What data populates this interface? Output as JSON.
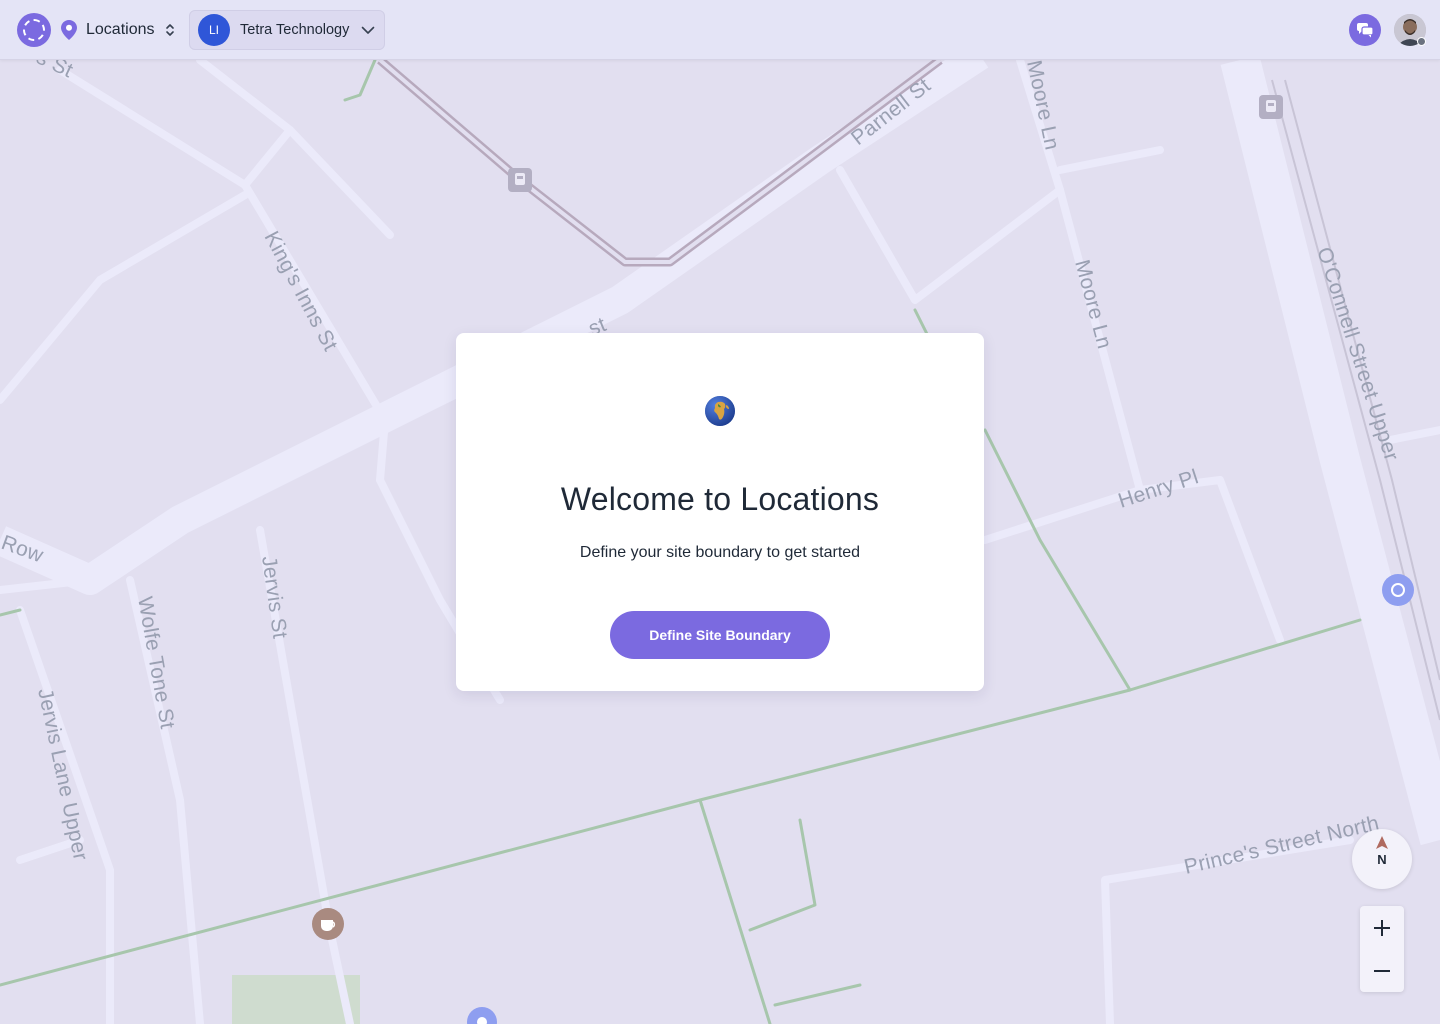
{
  "header": {
    "location_switcher_label": "Locations",
    "org": {
      "initials": "LI",
      "name": "Tetra Technology"
    }
  },
  "map": {
    "street_labels": [
      "Parnell St",
      "King's Inns St",
      "Moore Ln",
      "Moore Ln",
      "O'Connell Street Upper",
      "Henry Pl",
      "Row",
      "Wolfe Tone St",
      "Jervis St",
      "Jervis Lane Upper",
      "Prince's Street North",
      "s St",
      "st"
    ],
    "compass_label": "N",
    "zoom_in_label": "+",
    "zoom_out_label": "−"
  },
  "welcome": {
    "title": "Welcome to Locations",
    "subtitle": "Define your site boundary to get started",
    "button_label": "Define Site Boundary"
  },
  "colors": {
    "accent": "#7b6ae0",
    "org_badge": "#2f56d8",
    "map_background": "#e2dff0",
    "road": "#ebeafa",
    "rail": "#b7a9bd",
    "path_green": "#a7c6ac"
  }
}
